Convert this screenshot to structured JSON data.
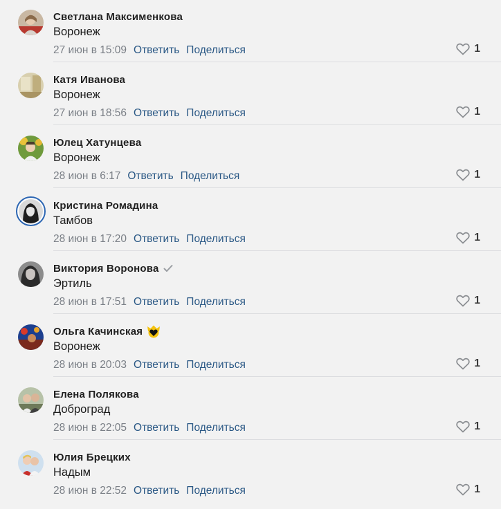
{
  "labels": {
    "reply": "Ответить",
    "share": "Поделиться"
  },
  "comments": [
    {
      "author": "Светлана Максименкова",
      "text": "Воронеж",
      "date": "27 июн в 15:09",
      "likes": "1"
    },
    {
      "author": "Катя Иванова",
      "text": "Воронеж",
      "date": "27 июн в 18:56",
      "likes": "1"
    },
    {
      "author": "Юлец Хатунцева",
      "text": "Воронеж",
      "date": "28 июн в 6:17",
      "likes": "1"
    },
    {
      "author": "Кристина Ромадина",
      "text": "Тамбов",
      "date": "28 июн в 17:20",
      "likes": "1"
    },
    {
      "author": "Виктория Воронова",
      "text": "Эртиль",
      "date": "28 июн в 17:51",
      "likes": "1",
      "badge": "verified-check-icon"
    },
    {
      "author": "Ольга Качинская",
      "text": "Воронеж",
      "date": "28 июн в 20:03",
      "likes": "1",
      "badge": "heart-crown-icon"
    },
    {
      "author": "Елена Полякова",
      "text": "Доброград",
      "date": "28 июн в 22:05",
      "likes": "1"
    },
    {
      "author": "Юлия Брецких",
      "text": "Надым",
      "date": "28 июн в 22:52",
      "likes": "1"
    }
  ],
  "colors": {
    "background": "#f2f2f2",
    "link": "#2a5885",
    "meta": "#7a7f86",
    "avatar_ring": "#2c66b3"
  }
}
